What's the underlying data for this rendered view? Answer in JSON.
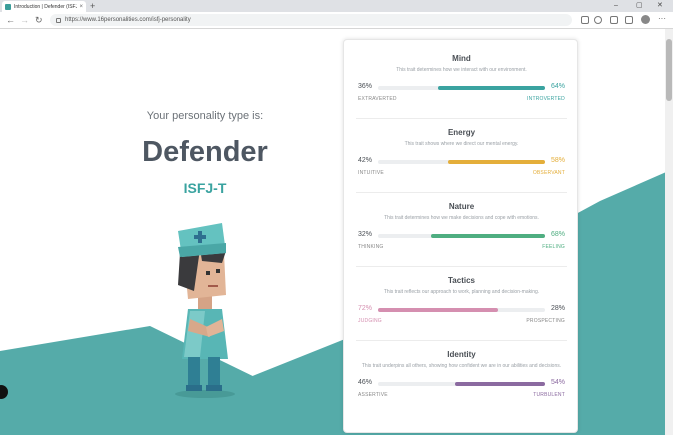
{
  "browser": {
    "tab_title": "Introduction | Defender (ISFJ) Pe",
    "tab_close": "×",
    "new_tab": "+",
    "url": "https://www.16personalities.com/isfj-personality",
    "controls": {
      "minimize": "–",
      "maximize": "▢",
      "close": "✕"
    },
    "nav": {
      "back": "←",
      "forward": "→",
      "reload": "↻"
    },
    "menu": "···"
  },
  "hero": {
    "intro": "Your personality type is:",
    "type_name": "Defender",
    "type_code": "ISFJ-T"
  },
  "colors": {
    "teal": "#3aa3a0",
    "teal_bg": "#55aba9",
    "mind": "#3aa3a0",
    "energy": "#e4ae3a",
    "nature": "#4fae81",
    "tactics": "#d58fb0",
    "identity": "#8b6aa0"
  },
  "traits": [
    {
      "name": "Mind",
      "desc": "This trait determines how we interact with our environment.",
      "left_pct": "36%",
      "right_pct": "64%",
      "left_label": "EXTRAVERTED",
      "right_label": "INTROVERTED",
      "dominant": "right",
      "value": 0.64,
      "color": "#3aa3a0"
    },
    {
      "name": "Energy",
      "desc": "This trait shows where we direct our mental energy.",
      "left_pct": "42%",
      "right_pct": "58%",
      "left_label": "INTUITIVE",
      "right_label": "OBSERVANT",
      "dominant": "right",
      "value": 0.58,
      "color": "#e4ae3a"
    },
    {
      "name": "Nature",
      "desc": "This trait determines how we make decisions and cope with emotions.",
      "left_pct": "32%",
      "right_pct": "68%",
      "left_label": "THINKING",
      "right_label": "FEELING",
      "dominant": "right",
      "value": 0.68,
      "color": "#4fae81"
    },
    {
      "name": "Tactics",
      "desc": "This trait reflects our approach to work, planning and decision-making.",
      "left_pct": "72%",
      "right_pct": "28%",
      "left_label": "JUDGING",
      "right_label": "PROSPECTING",
      "dominant": "left",
      "value": 0.72,
      "color": "#d58fb0"
    },
    {
      "name": "Identity",
      "desc": "This trait underpins all others, showing how confident we are in our abilities and decisions.",
      "left_pct": "46%",
      "right_pct": "54%",
      "left_label": "ASSERTIVE",
      "right_label": "TURBULENT",
      "dominant": "right",
      "value": 0.54,
      "color": "#8b6aa0"
    }
  ]
}
